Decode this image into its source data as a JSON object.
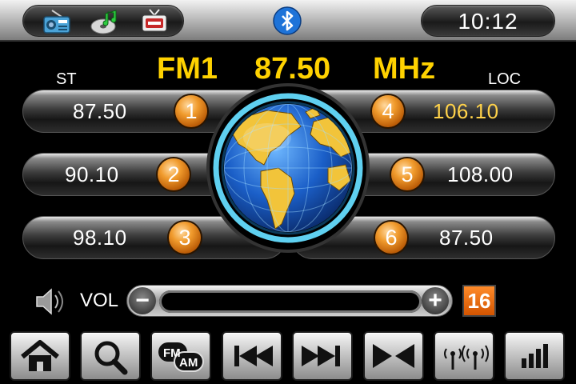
{
  "status_bar": {
    "apps": [
      {
        "name": "radio-app-icon"
      },
      {
        "name": "music-app-icon"
      },
      {
        "name": "tv-app-icon"
      }
    ],
    "bluetooth_icon": "bluetooth-icon",
    "clock": "10:12"
  },
  "tuner": {
    "band": "FM1",
    "frequency": "87.50",
    "unit": "MHz",
    "stereo_label": "ST",
    "local_label": "LOC"
  },
  "presets": [
    {
      "number": "1",
      "frequency": "87.50",
      "active": false
    },
    {
      "number": "2",
      "frequency": "90.10",
      "active": false
    },
    {
      "number": "3",
      "frequency": "98.10",
      "active": false
    },
    {
      "number": "4",
      "frequency": "106.10",
      "active": true
    },
    {
      "number": "5",
      "frequency": "108.00",
      "active": false
    },
    {
      "number": "6",
      "frequency": "87.50",
      "active": false
    }
  ],
  "volume": {
    "label": "VOL",
    "minus": "−",
    "plus": "+",
    "level": "16"
  },
  "toolbar": {
    "home": "home-icon",
    "search": "search-icon",
    "band_fm": "FM",
    "band_am": "AM",
    "prev": "seek-back-icon",
    "next": "seek-forward-icon",
    "scan": "scan-icon",
    "antenna": "antenna-icon",
    "eq": "equalizer-icon"
  },
  "colors": {
    "accent_yellow": "#ffd200",
    "badge_orange": "#f09a2c",
    "volume_level_bg": "#e06a10",
    "globe_ring": "#5fd0f0"
  }
}
